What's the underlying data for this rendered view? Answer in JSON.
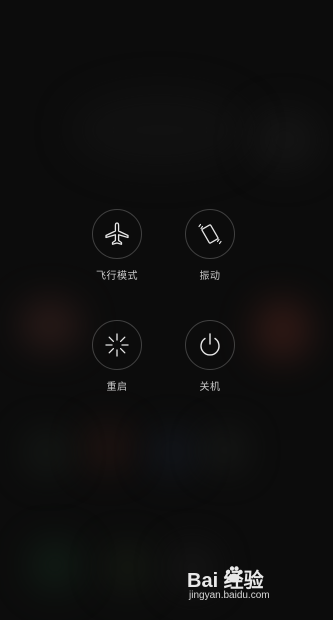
{
  "power_menu": {
    "airplane_label": "飞行模式",
    "vibrate_label": "振动",
    "reboot_label": "重启",
    "power_off_label": "关机"
  },
  "watermark": {
    "logo_text": "Bai 经验",
    "url": "jingyan.baidu.com"
  },
  "icons": [
    "airplane-icon",
    "vibrate-icon",
    "reboot-icon",
    "power-icon",
    "paw-icon"
  ],
  "colors": {
    "background": "#0c0c0c",
    "label": "#c8c8c8",
    "icon_stroke": "#e6e6e6"
  }
}
